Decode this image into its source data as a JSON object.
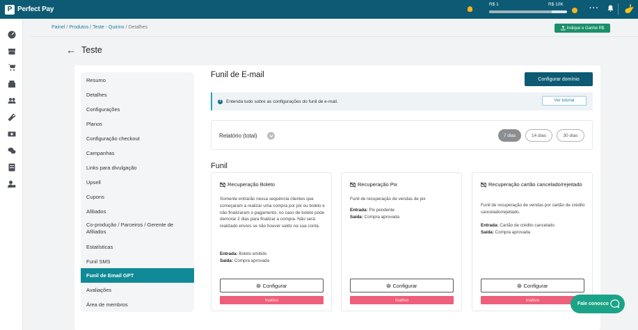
{
  "brand": {
    "name": "Perfect Pay",
    "mark": "P"
  },
  "topbar": {
    "gauge_min": "R$ 1",
    "gauge_max": "R$ 10K",
    "gauge_progress": 0.8,
    "icons": [
      "bulb-icon",
      "coin-icon",
      "more-icon",
      "bell-icon",
      "avatar"
    ]
  },
  "rail_icons": [
    "dashboard-icon",
    "store-icon",
    "cart-icon",
    "product-icon",
    "users-icon",
    "tools-icon",
    "finance-icon",
    "chat-icon",
    "report-icon",
    "user-settings-icon"
  ],
  "breadcrumb": {
    "painel": "Painel",
    "sep1": " / ",
    "produtos": "Produtos",
    "sep2": " / ",
    "teste": "Teste - Quirino",
    "sep3": " / ",
    "current": "Detalhes"
  },
  "indique_button": "Indique e Ganhe R$",
  "page_title": "Teste",
  "menu": [
    "Resumo",
    "Detalhes",
    "Configurações",
    "Planos",
    "Configuração checkout",
    "Campanhas",
    "Links para divulgação",
    "Upsell",
    "Cupons",
    "Afiliados",
    "Co-produção / Parceiros / Gerente de Afiliados",
    "Estatísticas",
    "Funil SMS",
    "Funil de Email GPT",
    "Avaliações",
    "Área de membros"
  ],
  "menu_active": "Funil de Email GPT",
  "content": {
    "heading": "Funil de E-mail",
    "configure_domain": "Configurar domínio",
    "info_text": "Entenda tudo sobre as configurações do funil de e-mail.",
    "tutorial_button": "Ver tutorial",
    "report_label": "Relatório (total)",
    "period_pills": [
      "7 dias",
      "14 dias",
      "30 dias"
    ],
    "period_selected": "7 dias",
    "funnel_heading": "Funil"
  },
  "funnels": [
    {
      "title": "Recuperação Boleto",
      "description": "Somente entrarão nessa sequência clientes que começaram a realizar uma compra por pix ou boleto e não finalizaram o pagamento, no caso de boleto pode demorar 2 dias para finalizar a compra. Não será realizado envios se não houver saldo na sua conta.",
      "entrada_label": "Entrada:",
      "entrada_value": "Boleto emitido",
      "saida_label": "Saída:",
      "saida_value": "Compra aprovada",
      "button": "Configurar",
      "status": "Inativo"
    },
    {
      "title": "Recuperação Pix",
      "description": "Funil de recuperação de vendas de pix",
      "entrada_label": "Entrada:",
      "entrada_value": "Pix pendente",
      "saida_label": "Saída:",
      "saida_value": "Compra aprovada",
      "button": "Configurar",
      "status": "Inativo"
    },
    {
      "title": "Recuperação cartão cancelado/rejeitado",
      "description": "Funil de recuperação de vendas por cartão de crédito cancelado/rejeitado.",
      "entrada_label": "Entrada:",
      "entrada_value": "Cartão de crédito cancelado",
      "saida_label": "Saída:",
      "saida_value": "Compra aprovada",
      "button": "Configurar",
      "status": "Inativo"
    }
  ],
  "chat_button": "Fale conosco",
  "colors": {
    "primary": "#0c5a73",
    "active_menu": "#0f8a96",
    "inactive": "#ee5f7b",
    "chat": "#1ba388",
    "indique": "#1a8f6c"
  }
}
